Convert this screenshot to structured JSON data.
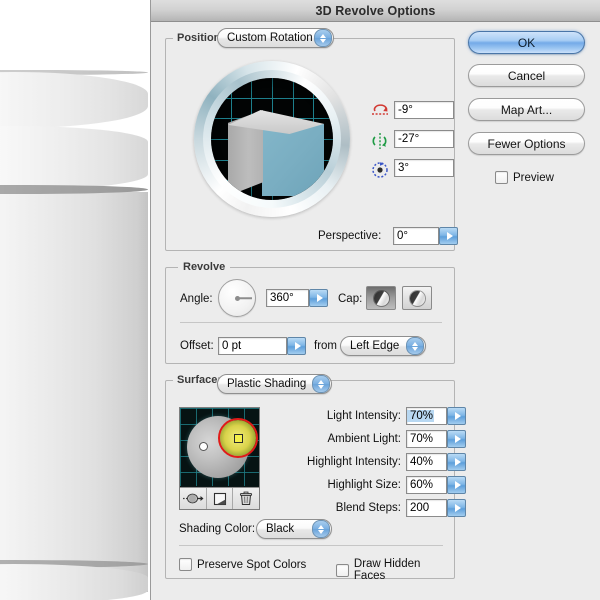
{
  "window": {
    "title": "3D Revolve Options"
  },
  "buttons": {
    "ok": "OK",
    "cancel": "Cancel",
    "map_art": "Map Art...",
    "fewer_options": "Fewer Options",
    "preview_label": "Preview",
    "preview_checked": false
  },
  "position": {
    "group_label": "Position:",
    "preset": "Custom Rotation",
    "rotation": {
      "x_icon": "rotate-x-axis-icon",
      "x_value": "-9°",
      "y_icon": "rotate-y-axis-icon",
      "y_value": "-27°",
      "z_icon": "rotate-z-axis-icon",
      "z_value": "3°"
    },
    "perspective_label": "Perspective:",
    "perspective_value": "0°",
    "trackball_icon": "3d-trackball-widget"
  },
  "revolve": {
    "group_label": "Revolve",
    "angle_label": "Angle:",
    "angle_value": "360°",
    "angle_dial_icon": "angle-dial",
    "cap_label": "Cap:",
    "cap_on_icon": "cap-on-icon",
    "cap_off_icon": "cap-off-icon",
    "cap_selected": "cap-on",
    "offset_label": "Offset:",
    "offset_value": "0 pt",
    "from_label": "from",
    "offset_from": "Left Edge"
  },
  "surface": {
    "group_label": "Surface:",
    "shading": "Plastic Shading",
    "light_preview_icon": "light-sphere-preview",
    "light_buttons": [
      {
        "icon": "move-light-behind-icon"
      },
      {
        "icon": "new-light-icon"
      },
      {
        "icon": "delete-light-trash-icon"
      }
    ],
    "fields": [
      {
        "label": "Light Intensity:",
        "value": "70%",
        "selected": true
      },
      {
        "label": "Ambient Light:",
        "value": "70%",
        "selected": false
      },
      {
        "label": "Highlight Intensity:",
        "value": "40%",
        "selected": false
      },
      {
        "label": "Highlight Size:",
        "value": "60%",
        "selected": false
      },
      {
        "label": "Blend Steps:",
        "value": "200",
        "selected": false
      }
    ],
    "shading_color_label": "Shading Color:",
    "shading_color_value": "Black",
    "preserve_spot_label": "Preserve Spot Colors",
    "preserve_spot_checked": false,
    "draw_hidden_label": "Draw Hidden Faces",
    "draw_hidden_checked": false
  },
  "colors": {
    "dialog_bg": "#ececec",
    "titlebar": "#cfcfcf",
    "accent_blue": "#74aae8",
    "cube_front_teal": "#79adc1",
    "globe_grid_teal": "#1d7f8c",
    "selection_red": "#e01b18",
    "light_yellow": "#f4f04a",
    "field_selection": "#b8d8f2"
  },
  "artwork": {
    "icon": "revolved-white-cylinder-3d-object"
  }
}
